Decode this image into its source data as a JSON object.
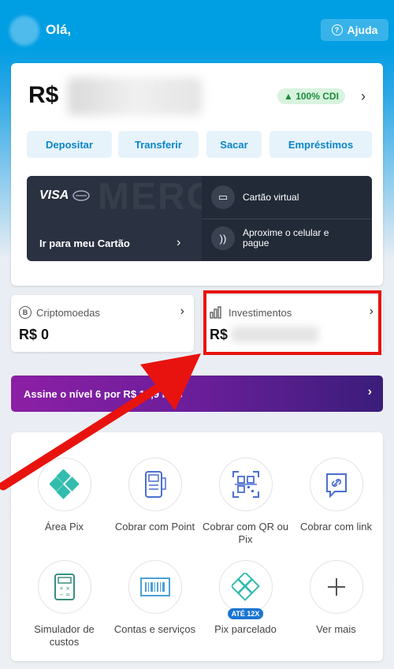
{
  "header": {
    "greeting": "Olá,",
    "help_label": "Ajuda"
  },
  "balance": {
    "currency": "R$",
    "cdi_badge": "▲ 100% CDI",
    "actions": [
      "Depositar",
      "Transferir",
      "Sacar",
      "Empréstimos"
    ]
  },
  "card_panel": {
    "brand": "VISA",
    "watermark": "MERCADO",
    "link": "Ir para meu Cartão",
    "virtual_card": "Cartão virtual",
    "contactless": "Aproxime o celular e pague"
  },
  "mini_cards": {
    "crypto": {
      "title": "Criptomoedas",
      "value": "R$ 0"
    },
    "investments": {
      "title": "Investimentos",
      "value": "R$"
    }
  },
  "promo": {
    "text": "Assine o nível 6 por R$ 14,9 mês"
  },
  "shortcuts": [
    {
      "label": "Área Pix",
      "icon": "pix-icon"
    },
    {
      "label": "Cobrar com Point",
      "icon": "point-device-icon"
    },
    {
      "label": "Cobrar com QR ou Pix",
      "icon": "qr-code-icon"
    },
    {
      "label": "Cobrar com link",
      "icon": "link-icon"
    },
    {
      "label": "Simulador de custos",
      "icon": "calculator-icon"
    },
    {
      "label": "Contas e serviços",
      "icon": "barcode-icon"
    },
    {
      "label": "Pix parcelado",
      "icon": "pix-installments-icon",
      "badge": "ATÉ 12X"
    },
    {
      "label": "Ver mais",
      "icon": "plus-icon"
    }
  ],
  "colors": {
    "brand_blue": "#009ee3",
    "highlight_red": "#e8130f",
    "pix_teal": "#32bcad"
  }
}
